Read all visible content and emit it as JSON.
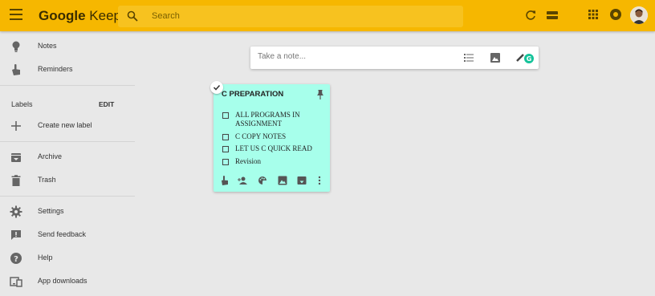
{
  "header": {
    "menu_icon": "hamburger-menu-icon",
    "logo_google": "Google",
    "logo_keep": "Keep",
    "search_placeholder": "Search",
    "icons": [
      "refresh-icon",
      "list-view-icon",
      "apps-grid-icon",
      "notifications-icon",
      "account-avatar"
    ],
    "color": "#f6b700"
  },
  "sidebar": {
    "items_top": [
      {
        "label": "Notes",
        "icon": "lightbulb-icon"
      },
      {
        "label": "Reminders",
        "icon": "reminder-hand-icon"
      }
    ],
    "labels_heading": "Labels",
    "labels_edit": "EDIT",
    "create_label": {
      "label": "Create new label",
      "icon": "plus-icon"
    },
    "items_mid": [
      {
        "label": "Archive",
        "icon": "archive-icon"
      },
      {
        "label": "Trash",
        "icon": "trash-icon"
      }
    ],
    "items_bottom": [
      {
        "label": "Settings",
        "icon": "gear-icon"
      },
      {
        "label": "Send feedback",
        "icon": "feedback-icon"
      },
      {
        "label": "Help",
        "icon": "help-icon"
      },
      {
        "label": "App downloads",
        "icon": "devices-icon"
      }
    ]
  },
  "take_note": {
    "placeholder": "Take a note...",
    "icons": [
      "new-list-icon",
      "new-image-icon",
      "new-drawing-icon"
    ]
  },
  "note": {
    "title": "C PREPARATION",
    "color": "#a7ffeb",
    "items": [
      {
        "text": "ALL PROGRAMS IN ASSIGNMENT",
        "checked": false
      },
      {
        "text": "C COPY NOTES",
        "checked": false
      },
      {
        "text": "LET US C QUICK READ",
        "checked": false
      },
      {
        "text": "Revision",
        "checked": false
      }
    ],
    "actions": [
      "remind-me-icon",
      "collaborator-icon",
      "change-color-icon",
      "add-image-icon",
      "archive-icon",
      "more-options-icon"
    ]
  }
}
